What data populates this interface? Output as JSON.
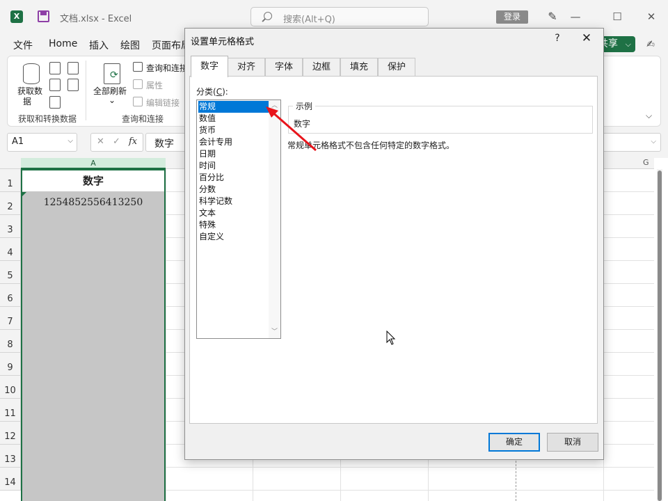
{
  "window": {
    "doc_title": "文档.xlsx  -  Excel",
    "search_placeholder": "搜索(Alt+Q)",
    "login_label": "登录",
    "minimize_label": "—",
    "maximize_label": "☐",
    "close_label": "✕"
  },
  "ribbon_tabs": [
    "文件",
    "Home",
    "插入",
    "绘图",
    "页面布局"
  ],
  "share_label": "共享",
  "ribbon": {
    "get_data_label": "获取数",
    "get_data_label2": "据",
    "refresh_all_label": "全部刷新",
    "queries_label": "查询和连接",
    "properties_label": "属性",
    "edit_links_label": "编辑链接",
    "group_get_transform": "获取和转换数据",
    "group_queries": "查询和连接"
  },
  "formula_bar": {
    "name_box": "A1",
    "cancel_icon": "✕",
    "enter_icon": "✓",
    "fx_label": "fx",
    "content": "数字"
  },
  "sheet": {
    "col_a": "A",
    "col_g": "G",
    "rows": [
      "1",
      "2",
      "3",
      "4",
      "5",
      "6",
      "7",
      "8",
      "9",
      "10",
      "11",
      "12",
      "13",
      "14"
    ],
    "a1": "数字",
    "a2": "1254852556413250"
  },
  "dialog": {
    "title": "设置单元格格式",
    "help_label": "?",
    "close_label": "✕",
    "tabs": [
      "数字",
      "对齐",
      "字体",
      "边框",
      "填充",
      "保护"
    ],
    "active_tab": "数字",
    "category_label": "分类(",
    "category_key": "C",
    "category_label_end": "):",
    "categories": [
      "常规",
      "数值",
      "货币",
      "会计专用",
      "日期",
      "时间",
      "百分比",
      "分数",
      "科学记数",
      "文本",
      "特殊",
      "自定义"
    ],
    "selected_category": "常规",
    "sample_legend": "示例",
    "sample_value": "数字",
    "description": "常规单元格格式不包含任何特定的数字格式。",
    "ok_label": "确定",
    "cancel_label": "取消"
  },
  "colors": {
    "excel_green": "#1e7145",
    "selection_blue": "#0078d7",
    "annotation_red": "#e8141b"
  }
}
